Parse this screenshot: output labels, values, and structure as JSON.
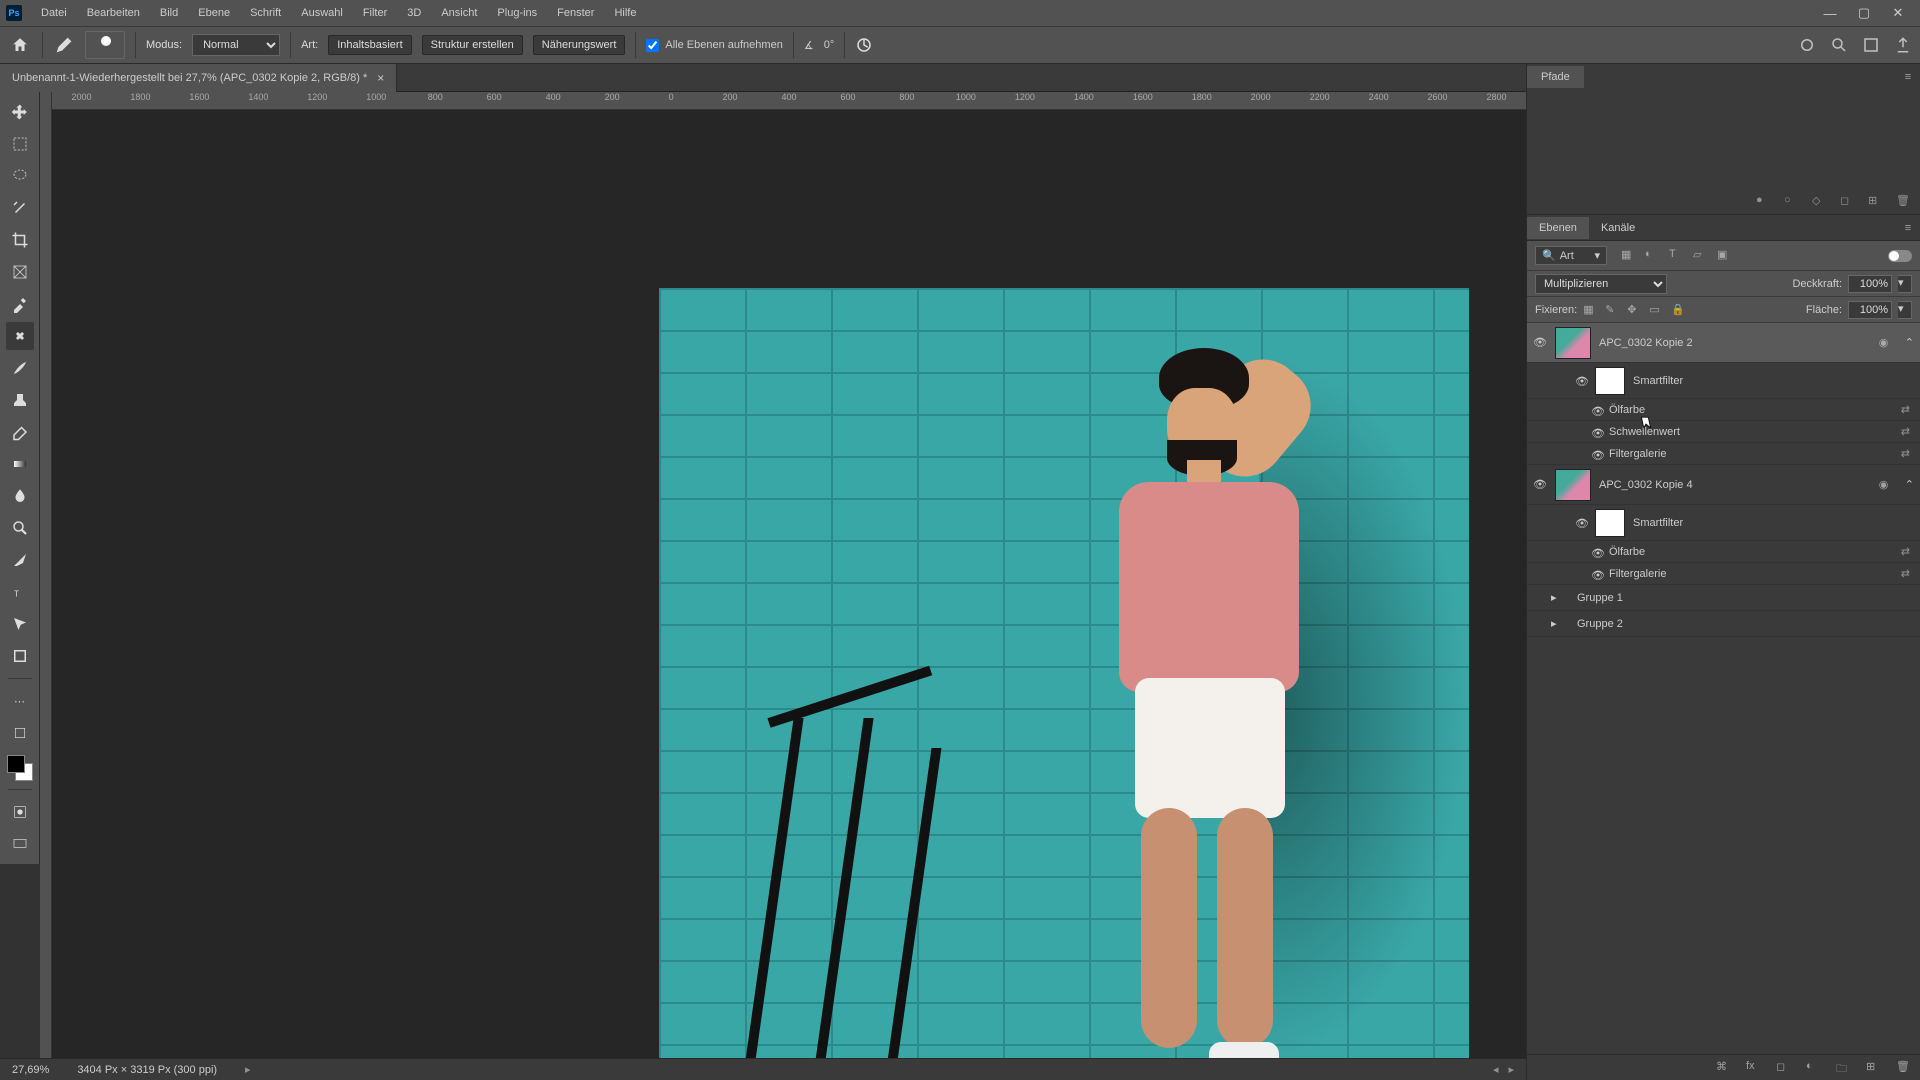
{
  "menu": {
    "items": [
      "Datei",
      "Bearbeiten",
      "Bild",
      "Ebene",
      "Schrift",
      "Auswahl",
      "Filter",
      "3D",
      "Ansicht",
      "Plug-ins",
      "Fenster",
      "Hilfe"
    ]
  },
  "window_controls": {
    "min": "—",
    "max": "▢",
    "close": "✕"
  },
  "optbar": {
    "modus_label": "Modus:",
    "modus_value": "Normal",
    "art_label": "Art:",
    "btn_inhalt": "Inhaltsbasiert",
    "btn_struktur": "Struktur erstellen",
    "btn_naeherung": "Näherungswert",
    "chk_alle": "Alle Ebenen aufnehmen",
    "angle": "0°"
  },
  "tab": {
    "title": "Unbenannt-1-Wiederhergestellt bei 27,7% (APC_0302 Kopie 2, RGB/8) *"
  },
  "ruler": {
    "ticks": [
      "2000",
      "1800",
      "1600",
      "1400",
      "1200",
      "1000",
      "800",
      "600",
      "400",
      "200",
      "0",
      "200",
      "400",
      "600",
      "800",
      "1000",
      "1200",
      "1400",
      "1600",
      "1800",
      "2000",
      "2200",
      "2400",
      "2600",
      "2800"
    ]
  },
  "status": {
    "zoom": "27,69%",
    "dims": "3404 Px × 3319 Px (300 ppi)"
  },
  "panels": {
    "pfade": "Pfade",
    "ebenen_tab": "Ebenen",
    "kanaele_tab": "Kanäle",
    "filter_label": "Art",
    "blend_label": "",
    "blend_value": "Multiplizieren",
    "deckkraft_label": "Deckkraft:",
    "deckkraft_value": "100%",
    "fixieren_label": "Fixieren:",
    "flaeche_label": "Fläche:",
    "flaeche_value": "100%"
  },
  "layers": [
    {
      "name": "APC_0302 Kopie 2",
      "selected": true,
      "smart": "Smartfilter",
      "filters": [
        "Ölfarbe",
        "Schwellenwert",
        "Filtergalerie"
      ]
    },
    {
      "name": "APC_0302 Kopie 4",
      "selected": false,
      "smart": "Smartfilter",
      "filters": [
        "Ölfarbe",
        "Filtergalerie"
      ]
    }
  ],
  "groups": [
    "Gruppe 1",
    "Gruppe 2"
  ]
}
